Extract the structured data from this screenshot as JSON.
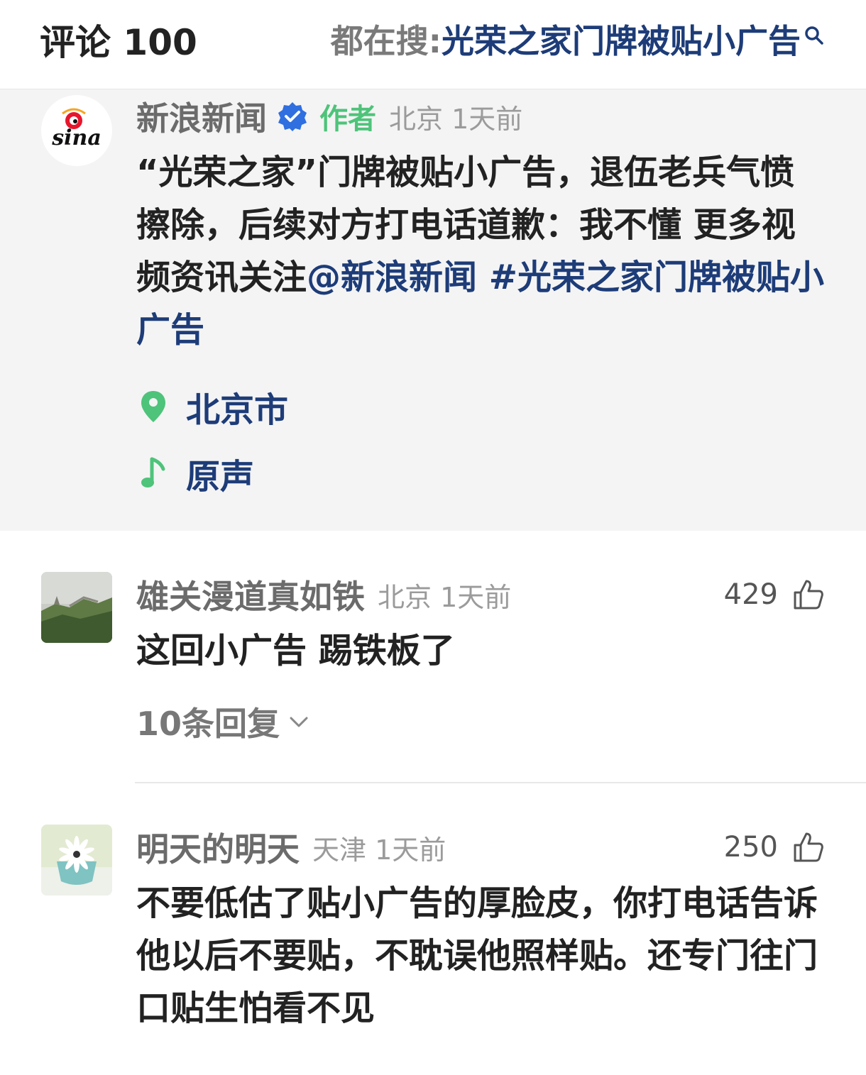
{
  "header": {
    "comment_count_label": "评论 100",
    "search_prefix": "都在搜:",
    "search_topic": "光荣之家门牌被贴小广告"
  },
  "post": {
    "author": "新浪新闻",
    "author_tag": "作者",
    "location_time": "北京 1天前",
    "avatar_logo_text": "sina",
    "content_text": "“光荣之家”门牌被贴小广告，退伍老兵气愤擦除，后续对方打电话道歉：我不懂 更多视频资讯关注",
    "mention": "@新浪新闻",
    "hashtag": "#光荣之家门牌被贴小广告",
    "location_tag": "北京市",
    "music_tag": "原声"
  },
  "comments": [
    {
      "user": "雄关漫道真如铁",
      "meta": "北京 1天前",
      "likes": "429",
      "text": "这回小广告 踢铁板了",
      "replies_label": "10条回复"
    },
    {
      "user": "明天的明天",
      "meta": "天津 1天前",
      "likes": "250",
      "text": "不要低估了贴小广告的厚脸皮，你打电话告诉他以后不要贴，不耽误他照样贴。还专门往门口贴生怕看不见"
    }
  ],
  "colors": {
    "link": "#1d3c78",
    "author_tag": "#4ec37a",
    "verified": "#2f6fe0",
    "post_bg": "#f4f4f4"
  }
}
